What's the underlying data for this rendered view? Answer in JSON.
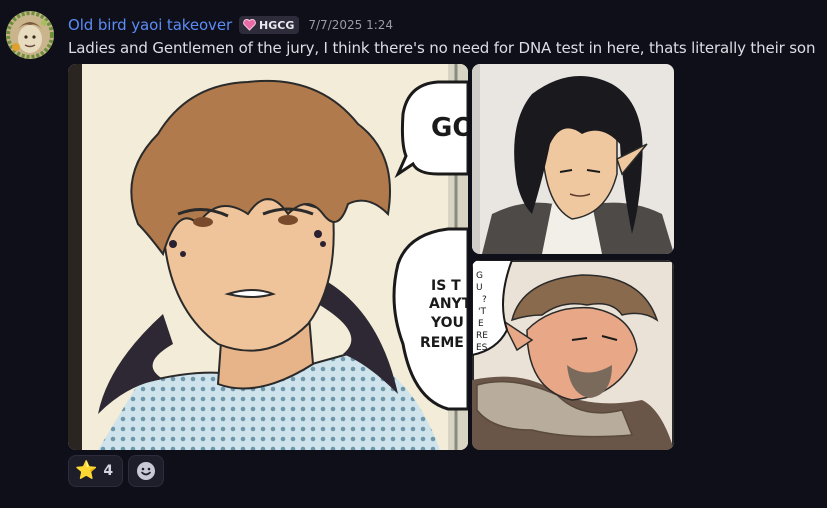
{
  "message": {
    "author": "Old bird yaoi takeover",
    "tag": "HGCG",
    "timestamp": "7/7/2025 1:24",
    "content": "Ladies and Gentlemen of the jury, I think there's no need for DNA test in here, thats literally their son"
  },
  "comic": {
    "bubble_top": "GO",
    "bubble_main": [
      "IS T",
      "ANYT",
      "YOU",
      "REME TES"
    ],
    "bubble_small": [
      "G",
      "U",
      "?",
      "'T",
      "E",
      "RE",
      "ES"
    ]
  },
  "reactions": [
    {
      "emoji": "star-icon",
      "glyph": "⭐",
      "count": "4"
    }
  ],
  "colors": {
    "username": "#5b8cf5",
    "background": "#0f0f1a",
    "tag_icon": "#e86aa6"
  }
}
